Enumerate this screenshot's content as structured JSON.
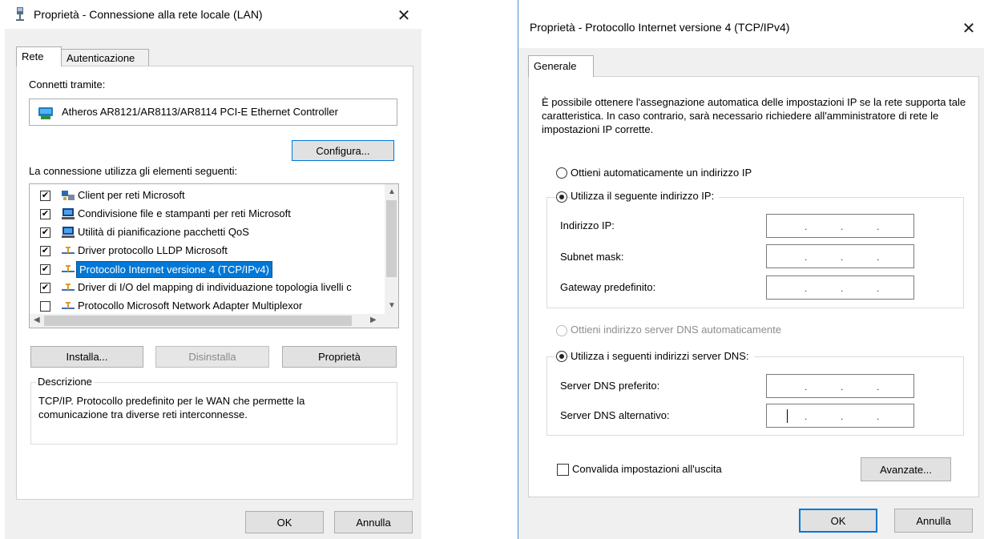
{
  "lan_dialog": {
    "title": "Proprietà - Connessione alla rete locale (LAN)",
    "tabs": [
      "Rete",
      "Autenticazione"
    ],
    "connect_using_label": "Connetti tramite:",
    "adapter_name": "Atheros AR8121/AR8113/AR8114 PCI-E Ethernet Controller",
    "configure_label": "Configura...",
    "items_label": "La connessione utilizza gli elementi seguenti:",
    "items": [
      {
        "label": "Client per reti Microsoft",
        "checked": true,
        "icon": "network-client-icon"
      },
      {
        "label": "Condivisione file e stampanti per reti Microsoft",
        "checked": true,
        "icon": "service-icon"
      },
      {
        "label": "Utilità di pianificazione pacchetti QoS",
        "checked": true,
        "icon": "service-icon"
      },
      {
        "label": "Driver protocollo LLDP Microsoft",
        "checked": true,
        "icon": "protocol-icon"
      },
      {
        "label": "Protocollo Internet versione 4 (TCP/IPv4)",
        "checked": true,
        "icon": "protocol-icon",
        "selected": true
      },
      {
        "label": "Driver di I/O del mapping di individuazione topologia livelli c",
        "checked": true,
        "icon": "protocol-icon"
      },
      {
        "label": "Protocollo Microsoft Network Adapter Multiplexor",
        "checked": false,
        "icon": "protocol-icon"
      }
    ],
    "install_label": "Installa...",
    "uninstall_label": "Disinstalla",
    "properties_label": "Proprietà",
    "description_label": "Descrizione",
    "description_text": "TCP/IP. Protocollo predefinito per le WAN che permette la comunicazione tra diverse reti interconnesse.",
    "ok_label": "OK",
    "cancel_label": "Annulla"
  },
  "ipv4_dialog": {
    "title": "Proprietà - Protocollo Internet versione 4 (TCP/IPv4)",
    "tab": "Generale",
    "intro_text": "È possibile ottenere l'assegnazione automatica delle impostazioni IP se la rete supporta tale caratteristica. In caso contrario, sarà necessario richiedere all'amministratore di rete le impostazioni IP corrette.",
    "auto_ip_label": "Ottieni automaticamente un indirizzo IP",
    "manual_ip_label": "Utilizza il seguente indirizzo IP:",
    "ip_address_label": "Indirizzo IP:",
    "subnet_label": "Subnet mask:",
    "gateway_label": "Gateway predefinito:",
    "auto_dns_label": "Ottieni indirizzo server DNS automaticamente",
    "manual_dns_label": "Utilizza i seguenti indirizzi server DNS:",
    "preferred_dns_label": "Server DNS preferito:",
    "alternate_dns_label": "Server DNS alternativo:",
    "validate_label": "Convalida impostazioni all'uscita",
    "advanced_label": "Avanzate...",
    "ok_label": "OK",
    "cancel_label": "Annulla",
    "ip_dot": "."
  },
  "close_glyph": "✕",
  "colors": {
    "accent": "#0078d7",
    "selection": "#0078d7",
    "dialog_bg": "#f0f0f0"
  }
}
